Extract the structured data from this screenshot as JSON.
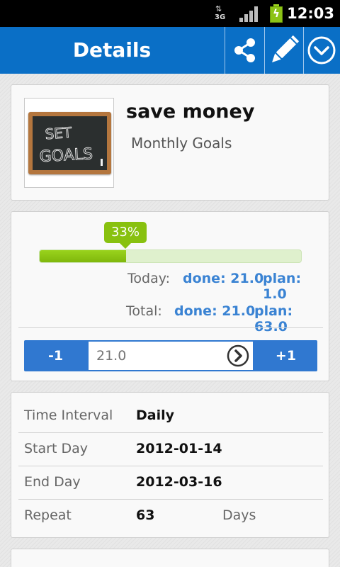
{
  "status_bar": {
    "network": "3G",
    "time": "12:03",
    "signal_icon": "signal-icon",
    "battery_icon": "battery-charging-icon"
  },
  "action_bar": {
    "title": "Details",
    "accent": "#0a6fc6",
    "actions": [
      {
        "icon": "share-icon"
      },
      {
        "icon": "pencil-icon"
      },
      {
        "icon": "chevron-down-circle-icon"
      }
    ]
  },
  "goal": {
    "title": "save money",
    "category": "Monthly Goals",
    "image_text": "SET GOALS"
  },
  "progress": {
    "percent_label": "33%",
    "fraction": 0.33,
    "today_label": "Today:",
    "today_done": "done: 21.0",
    "today_plan": "plan: 1.0",
    "total_label": "Total:",
    "total_done": "done: 21.0",
    "total_plan": "plan: 63.0"
  },
  "stepper": {
    "minus_label": "-1",
    "value": "21.0",
    "plus_label": "+1"
  },
  "details": {
    "rows": [
      {
        "label": "Time Interval",
        "value": "Daily"
      },
      {
        "label": "Start Day",
        "value": "2012-01-14"
      },
      {
        "label": "End Day",
        "value": "2012-03-16"
      },
      {
        "label": "Repeat",
        "value": "63",
        "unit": "Days"
      }
    ]
  }
}
